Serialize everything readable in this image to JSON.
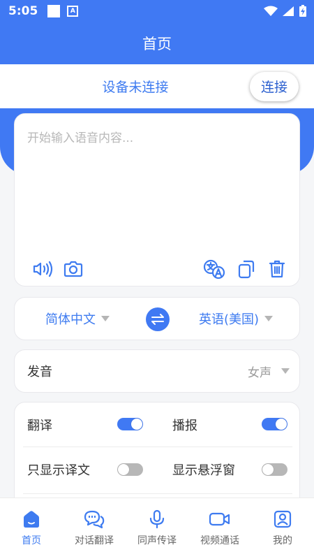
{
  "status_bar": {
    "time": "5:05",
    "a_label": "A"
  },
  "header": {
    "title": "首页"
  },
  "connection": {
    "status": "设备未连接",
    "connect_label": "连接"
  },
  "input": {
    "placeholder": "开始输入语音内容..."
  },
  "language": {
    "source": "简体中文",
    "target": "英语(美国)"
  },
  "voice": {
    "label": "发音",
    "value": "女声"
  },
  "toggles": [
    {
      "label": "翻译",
      "on": true
    },
    {
      "label": "播报",
      "on": true
    },
    {
      "label": "只显示译文",
      "on": false
    },
    {
      "label": "显示悬浮窗",
      "on": false
    }
  ],
  "nav": [
    {
      "label": "首页",
      "icon": "home-icon",
      "active": true
    },
    {
      "label": "对话翻译",
      "icon": "chat-icon",
      "active": false
    },
    {
      "label": "同声传译",
      "icon": "microphone-icon",
      "active": false
    },
    {
      "label": "视频通话",
      "icon": "video-camera-icon",
      "active": false
    },
    {
      "label": "我的",
      "icon": "profile-icon",
      "active": false
    }
  ],
  "colors": {
    "primary": "#4079f3",
    "text_accent": "#3e7bf0"
  }
}
